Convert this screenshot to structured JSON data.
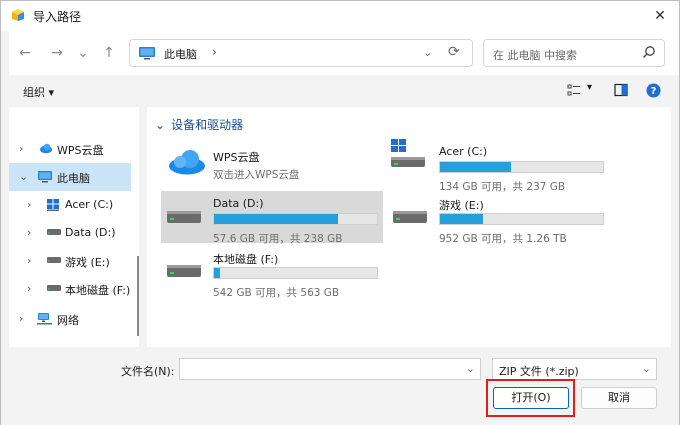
{
  "window": {
    "title": "导入路径",
    "close_glyph": "✕"
  },
  "nav": {
    "back_glyph": "←",
    "forward_glyph": "→",
    "recent_glyph": "⌄",
    "up_glyph": "↑",
    "address_crumb": "此电脑",
    "address_chevron": "›",
    "address_dropdown": "⌄",
    "refresh_glyph": "⟳",
    "search_placeholder": "在 此电脑 中搜索"
  },
  "toolbar": {
    "organize_label": "组织 ▾",
    "view_dropdown": "▾"
  },
  "sidebar": {
    "items": [
      {
        "label": "WPS云盘",
        "icon": "cloud-icon",
        "arrow": "›"
      },
      {
        "label": "此电脑",
        "icon": "pc-icon",
        "arrow": "⌄"
      },
      {
        "label": "Acer (C:)",
        "icon": "windows-drive-icon",
        "arrow": "›"
      },
      {
        "label": "Data (D:)",
        "icon": "drive-icon",
        "arrow": "›"
      },
      {
        "label": "游戏 (E:)",
        "icon": "drive-icon",
        "arrow": "›"
      },
      {
        "label": "本地磁盘 (F:)",
        "icon": "drive-icon",
        "arrow": "›"
      },
      {
        "label": "网络",
        "icon": "network-icon",
        "arrow": "›"
      }
    ]
  },
  "content": {
    "section_title": "设备和驱动器",
    "section_chevron": "⌄",
    "wps": {
      "name": "WPS云盘",
      "sub": "双击进入WPS云盘"
    },
    "drives": [
      {
        "name": "Acer (C:)",
        "free": "134 GB 可用，共 237 GB",
        "used_fraction": 0.435
      },
      {
        "name": "Data (D:)",
        "free": "57.6 GB 可用，共 238 GB",
        "used_fraction": 0.758
      },
      {
        "name": "游戏 (E:)",
        "free": "952 GB 可用，共 1.26 TB",
        "used_fraction": 0.262
      },
      {
        "name": "本地磁盘 (F:)",
        "free": "542 GB 可用，共 563 GB",
        "used_fraction": 0.037
      }
    ]
  },
  "bottom": {
    "filename_label": "文件名(N):",
    "filename_value": "",
    "filename_dropdown": "⌄",
    "filetype_value": "ZIP 文件 (*.zip)",
    "filetype_dropdown": "⌄",
    "open_label": "打开(O)",
    "cancel_label": "取消"
  },
  "colors": {
    "accent": "#26a0da",
    "highlight": "#e01e1e",
    "selection": "#cce4f7"
  }
}
